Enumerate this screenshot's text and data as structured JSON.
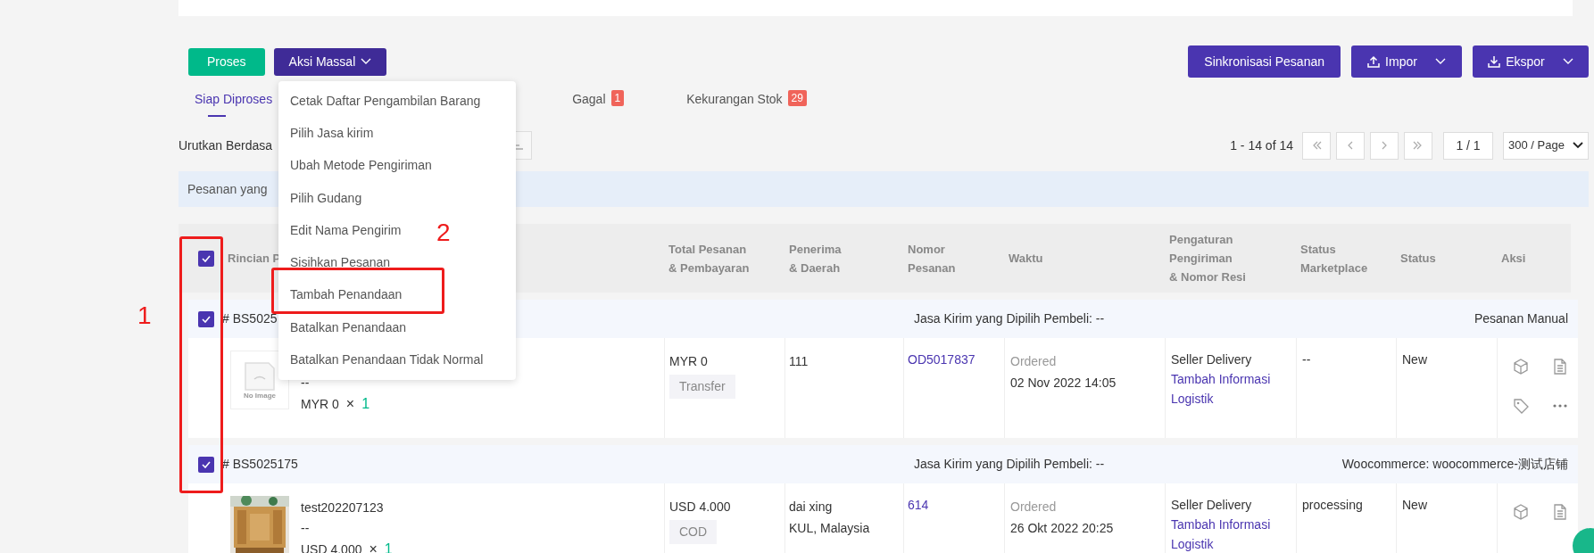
{
  "toolbar": {
    "process_button": "Proses",
    "bulk_button": "Aksi Massal",
    "sync_button": "Sinkronisasi Pesanan",
    "import_button": "Impor",
    "export_button": "Ekspor"
  },
  "tabs": [
    {
      "label": "Siap Diproses",
      "selected": true
    },
    {
      "label": "Gagal",
      "badge": "1",
      "selected": false
    },
    {
      "label": "Kekurangan Stok",
      "badge": "29",
      "selected": false
    }
  ],
  "sort": {
    "label": "Urutkan Berdasa"
  },
  "pagination": {
    "range": "1 - 14 of 14",
    "page": "1 / 1",
    "page_size": "300 / Page"
  },
  "notice": "Pesanan yang",
  "table": {
    "select_all_checked": true,
    "columns": [
      [
        "Rincian P"
      ],
      [
        "Total Pesanan",
        "& Pembayaran"
      ],
      [
        "Penerima",
        "& Daerah"
      ],
      [
        "Nomor",
        "Pesanan"
      ],
      [
        "Waktu"
      ],
      [
        "Pengaturan",
        "Pengiriman",
        "& Nomor Resi"
      ],
      [
        "Status",
        "Marketplace"
      ],
      [
        "Status"
      ],
      [
        "Aksi"
      ]
    ]
  },
  "orders": [
    {
      "checked": true,
      "order_id": "# BS5025",
      "courier": "Jasa Kirim yang Dipilih Pembeli: --",
      "source": "Pesanan Manual",
      "product": {
        "no_image_label": "No Image",
        "variant": "--",
        "price": "MYR 0",
        "times": "×",
        "qty": "1"
      },
      "total": "MYR 0",
      "payment": "Transfer",
      "recipient": [
        "111"
      ],
      "order_no": "OD5017837",
      "time_label": "Ordered",
      "time": "02 Nov 2022 14:05",
      "shipping": "Seller Delivery",
      "shipping_link": "Tambah Informasi Logistik",
      "marketplace_status": "--",
      "status": "New",
      "actions": [
        {
          "kind": "box"
        },
        {
          "kind": "document"
        },
        {
          "kind": "tag"
        },
        {
          "kind": "more"
        }
      ]
    },
    {
      "checked": true,
      "order_id": "# BS5025175",
      "courier": "Jasa Kirim yang Dipilih Pembeli: --",
      "source": "Woocommerce: woocommerce-测试店铺",
      "product": {
        "name": "test202207123",
        "variant": "--",
        "price": "USD 4.000",
        "times": "×",
        "qty": "1"
      },
      "total": "USD 4.000",
      "payment": "COD",
      "recipient": [
        "dai xing",
        "KUL, Malaysia"
      ],
      "order_no": "614",
      "time_label": "Ordered",
      "time": "26 Okt 2022 20:25",
      "shipping": "Seller Delivery",
      "shipping_link": "Tambah Informasi Logistik",
      "marketplace_status": "processing",
      "status": "New",
      "actions": [
        {
          "kind": "box"
        },
        {
          "kind": "document"
        }
      ]
    }
  ],
  "bulk_menu": {
    "items": [
      "Cetak Daftar Pengambilan Barang",
      "Pilih Jasa kirim",
      "Ubah Metode Pengiriman",
      "Pilih Gudang",
      "Edit Nama Pengirim",
      "Sisihkan Pesanan",
      "Tambah Penandaan",
      "Batalkan Penandaan",
      "Batalkan Penandaan Tidak Normal"
    ]
  },
  "annotations": [
    {
      "label": "1"
    },
    {
      "label": "2"
    }
  ]
}
